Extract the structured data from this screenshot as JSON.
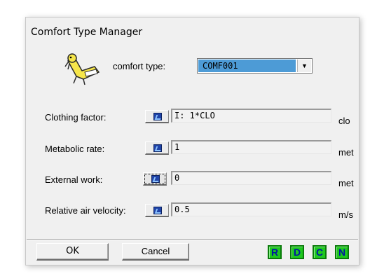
{
  "window": {
    "title": "Comfort Type Manager"
  },
  "mascot": {
    "icon": "reclining-figure-icon"
  },
  "comfort_type": {
    "label": "comfort type:",
    "selected": "COMF001",
    "dropdown_arrow": "▼"
  },
  "rows": [
    {
      "label": "Clothing factor:",
      "value": "I: 1*CLO",
      "unit": "clo",
      "icon": "edit-icon"
    },
    {
      "label": "Metabolic rate:",
      "value": "1",
      "unit": "met",
      "icon": "edit-icon"
    },
    {
      "label": "External work:",
      "value": "0",
      "unit": "met",
      "icon": "edit-icon"
    },
    {
      "label": "Relative air velocity:",
      "value": "0.5",
      "unit": "m/s",
      "icon": "edit-icon"
    }
  ],
  "buttons": {
    "ok": "OK",
    "cancel": "Cancel",
    "r": "R",
    "d": "D",
    "c": "C",
    "n": "N"
  },
  "colors": {
    "selection": "#4d9bd6",
    "letter_button_bg": "#1ec81e",
    "letter_button_text": "#0018a0"
  }
}
